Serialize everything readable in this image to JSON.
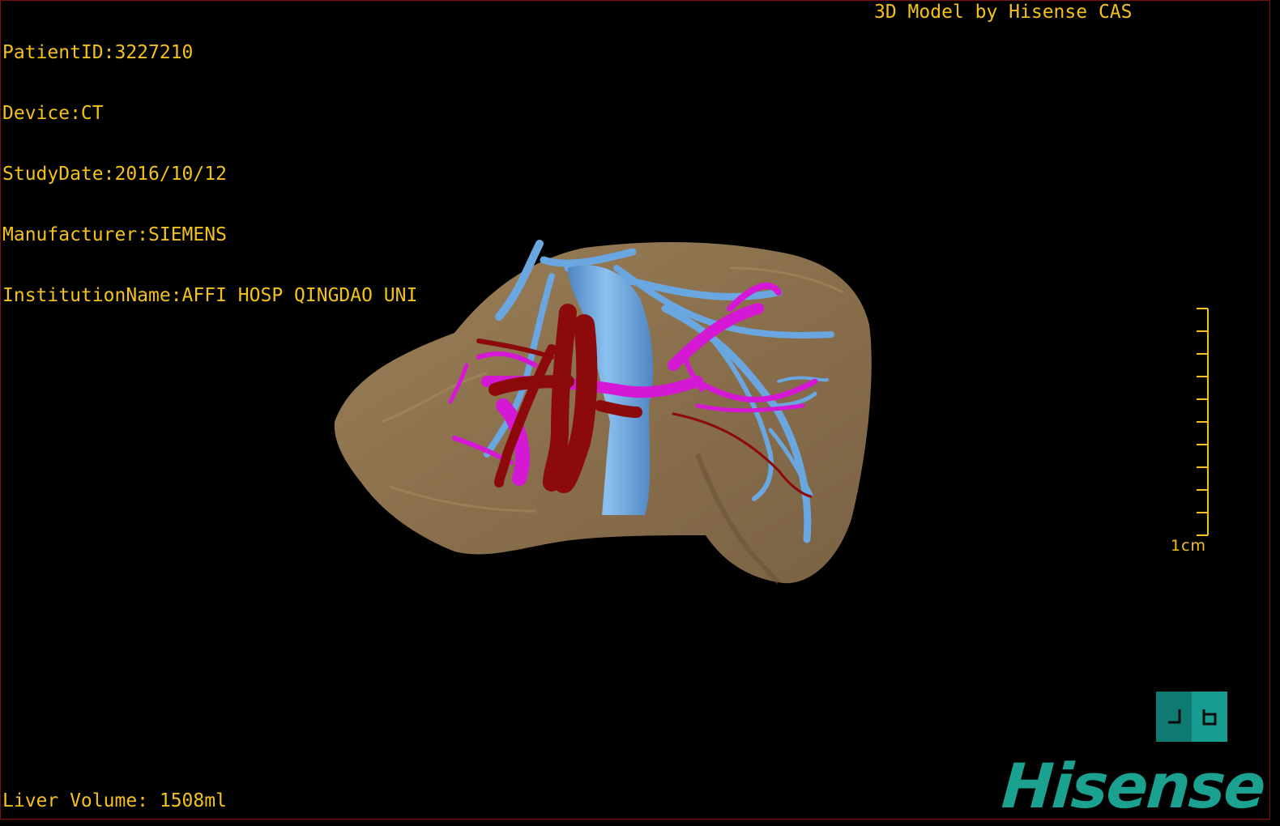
{
  "patient_info": {
    "patient_id": "PatientID:3227210",
    "device": "Device:CT",
    "study_date": "StudyDate:2016/10/12",
    "manufacturer": "Manufacturer:SIEMENS",
    "institution": "InstitutionName:AFFI HOSP QINGDAO UNI"
  },
  "credit": "3D Model by Hisense CAS",
  "liver_volume": "Liver Volume: 1508ml",
  "scale": {
    "label": "1cm"
  },
  "brand": {
    "name": "Hisense"
  },
  "colors": {
    "overlay_text": "#f2c21a",
    "liver": "#8c7350",
    "hepatic_vein": "#6aa6e0",
    "portal_vein": "#d418d4",
    "artery": "#8c0a0a",
    "brand": "#1aa190",
    "frame": "#7a1010"
  },
  "icons": {
    "view_toggle": "perspective-toggle-icon",
    "logo": "hisense-logo"
  }
}
